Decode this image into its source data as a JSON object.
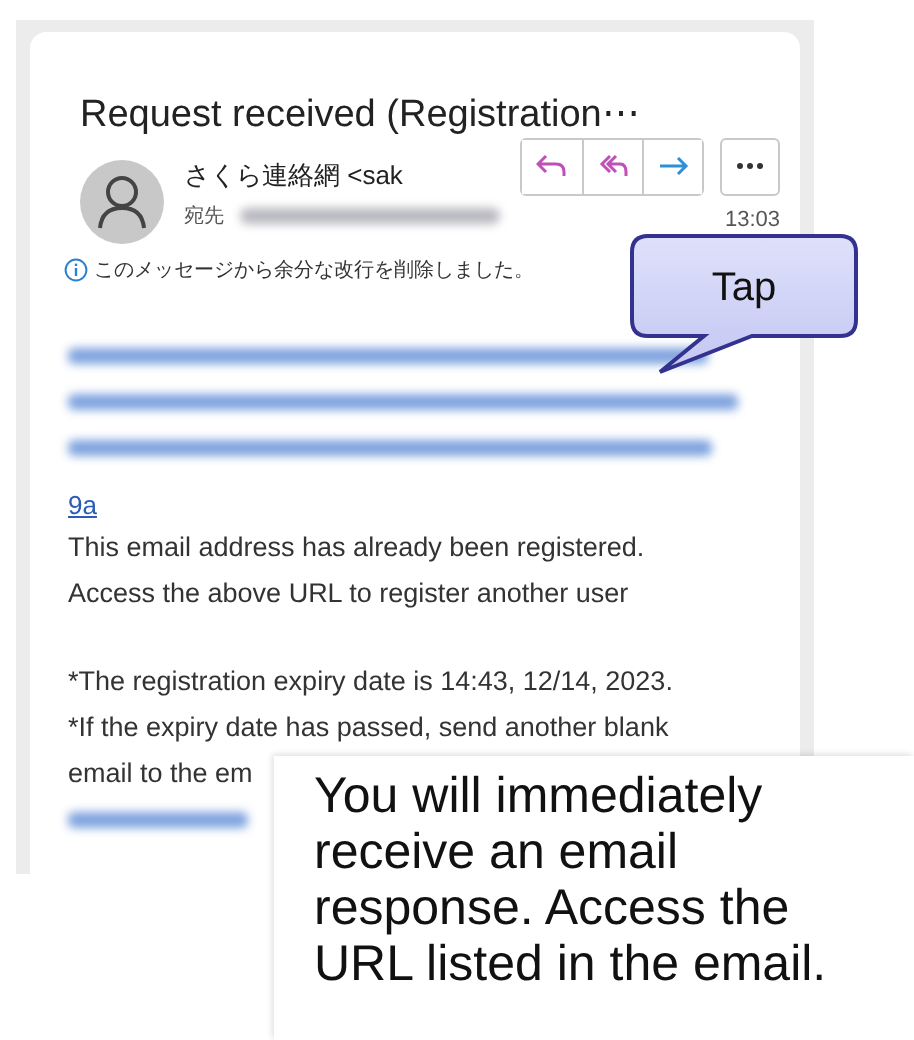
{
  "email": {
    "title": "Request received (Registration⋯",
    "sender": "さくら連絡網 <sak",
    "to_label": "宛先",
    "time": "13:03",
    "notice": "このメッセージから余分な改行を削除しました。",
    "link_tail": "9a",
    "paragraphs": [
      {
        "lines": [
          "This email address has already been registered.",
          "Access the above URL to register another user"
        ]
      },
      {
        "lines": [
          "*The registration expiry date is 14:43, 12/14, 2023.",
          "*If the expiry date has passed, send another blank",
          "email to the em"
        ]
      }
    ]
  },
  "callout": {
    "label": "Tap"
  },
  "caption": {
    "text": "You will immediately receive an email response. Access the URL listed in the email."
  }
}
